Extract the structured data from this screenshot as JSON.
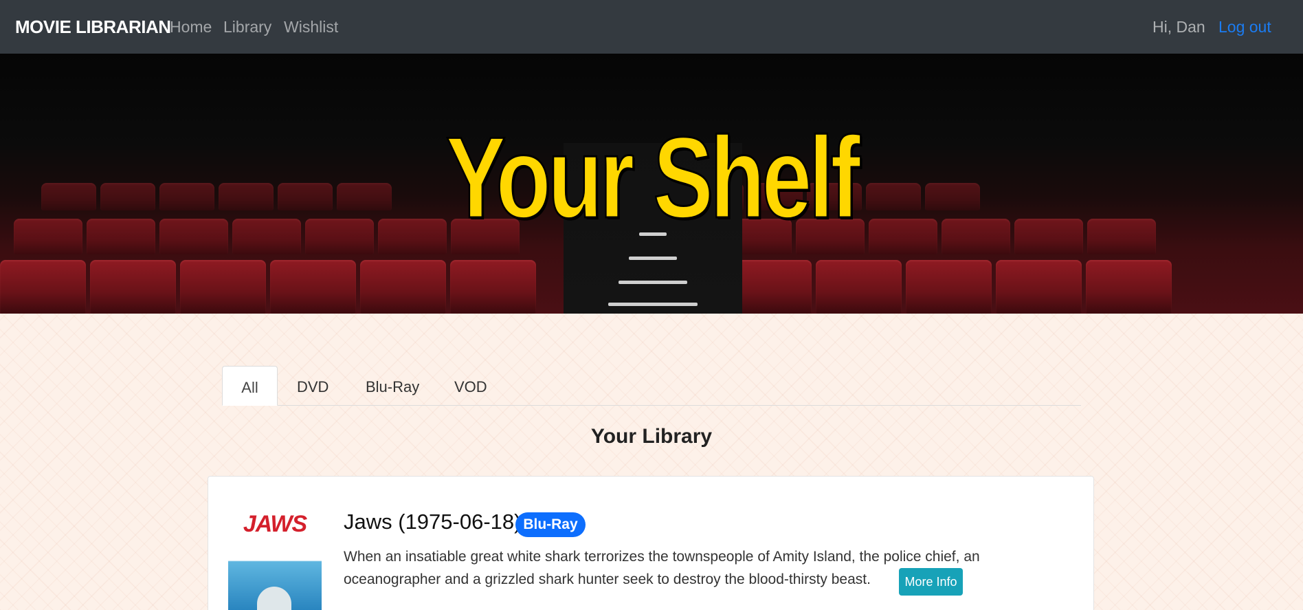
{
  "navbar": {
    "brand": "MOVIE LIBRARIAN",
    "links": {
      "home": "Home",
      "library": "Library",
      "wishlist": "Wishlist"
    },
    "greeting": "Hi, Dan",
    "logout": "Log out"
  },
  "hero": {
    "title": "Your Shelf"
  },
  "tabs": {
    "all": "All",
    "dvd": "DVD",
    "bluray": "Blu-Ray",
    "vod": "VOD",
    "active": "All"
  },
  "library": {
    "heading": "Your Library"
  },
  "movie": {
    "title": "Jaws (1975-06-18)",
    "format_badge": "Blu-Ray",
    "poster_logo": "JAWS",
    "description": "When an insatiable great white shark terrorizes the townspeople of Amity Island, the police chief, an oceanographer and a grizzled shark hunter seek to destroy the blood-thirsty beast.",
    "more_info": "More Info"
  },
  "colors": {
    "navbar_bg": "#343a40",
    "hero_title": "#ffd700",
    "badge": "#0d6efd",
    "more_info": "#17a2b8",
    "logout": "#1b7cf2"
  }
}
